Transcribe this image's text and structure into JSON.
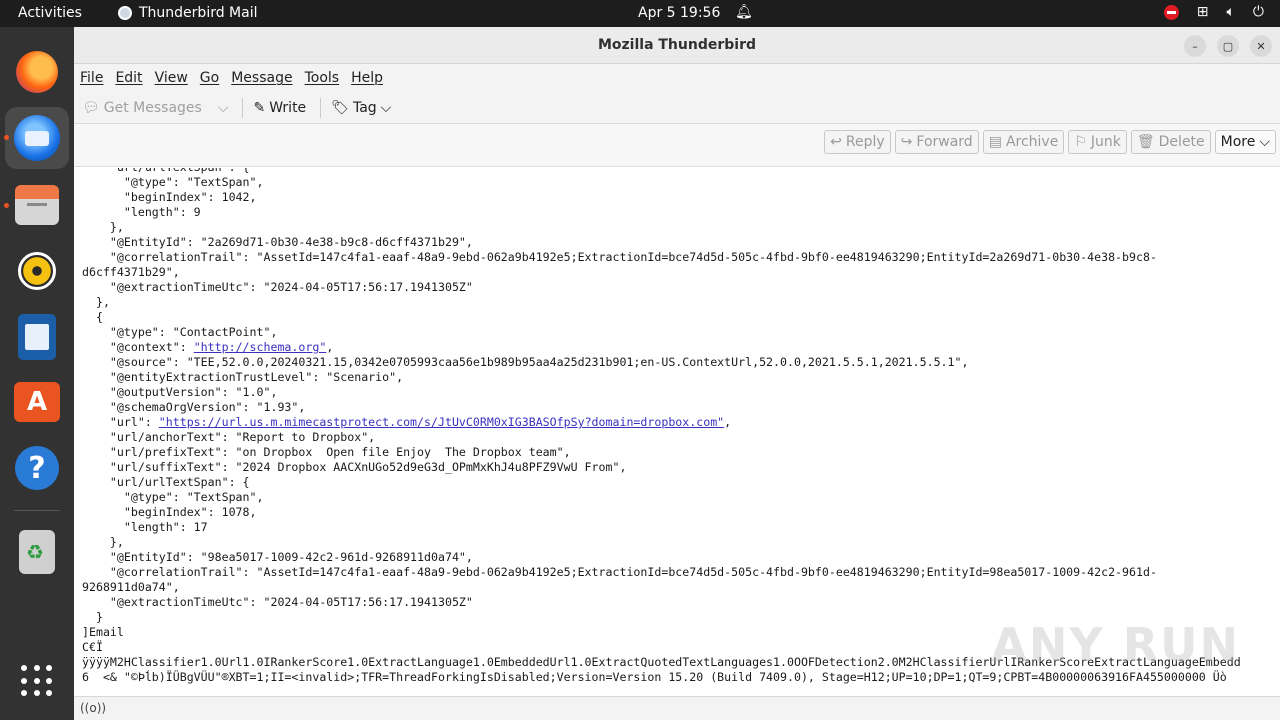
{
  "topbar": {
    "activities": "Activities",
    "app_name": "Thunderbird Mail",
    "clock": "Apr 5  19:56"
  },
  "dock": {
    "items": [
      "firefox-icon",
      "thunderbird-icon",
      "files-icon",
      "rhythmbox-icon",
      "writer-icon",
      "app-center-icon",
      "help-icon",
      "trash-icon",
      "show-apps-icon"
    ]
  },
  "window": {
    "title": "Mozilla Thunderbird",
    "controls": {
      "minimize": "–",
      "maximize": "▢",
      "close": "✕"
    }
  },
  "menu": {
    "file": "File",
    "edit": "Edit",
    "view": "View",
    "go": "Go",
    "message": "Message",
    "tools": "Tools",
    "help": "Help"
  },
  "toolbar": {
    "get_messages": "Get Messages",
    "write": "Write",
    "tag": "Tag"
  },
  "actions": {
    "reply": "Reply",
    "forward": "Forward",
    "archive": "Archive",
    "junk": "Junk",
    "delete": "Delete",
    "more": "More"
  },
  "message_body": {
    "lines": [
      "    \"url/urlTextSpan\": {",
      "      \"@type\": \"TextSpan\",",
      "      \"beginIndex\": 1042,",
      "      \"length\": 9",
      "    },",
      "    \"@EntityId\": \"2a269d71-0b30-4e38-b9c8-d6cff4371b29\",",
      "    \"@correlationTrail\": \"AssetId=147c4fa1-eaaf-48a9-9ebd-062a9b4192e5;ExtractionId=bce74d5d-505c-4fbd-9bf0-ee4819463290;EntityId=2a269d71-0b30-4e38-b9c8-",
      "d6cff4371b29\",",
      "    \"@extractionTimeUtc\": \"2024-04-05T17:56:17.1941305Z\"",
      "  },",
      "  {",
      "    \"@type\": \"ContactPoint\",",
      "    \"@context\": ",
      "    \"@source\": \"TEE,52.0.0,20240321.15,0342e0705993caa56e1b989b95aa4a25d231b901;en-US.ContextUrl,52.0.0,2021.5.5.1,2021.5.5.1\",",
      "    \"@entityExtractionTrustLevel\": \"Scenario\",",
      "    \"@outputVersion\": \"1.0\",",
      "    \"@schemaOrgVersion\": \"1.93\",",
      "    \"url\": ",
      "    \"url/anchorText\": \"Report to Dropbox\",",
      "    \"url/prefixText\": \"on Dropbox  Open file Enjoy  The Dropbox team\",",
      "    \"url/suffixText\": \"2024 Dropbox AACXnUGo52d9eG3d_OPmMxKhJ4u8PFZ9VwU From\",",
      "    \"url/urlTextSpan\": {",
      "      \"@type\": \"TextSpan\",",
      "      \"beginIndex\": 1078,",
      "      \"length\": 17",
      "    },",
      "    \"@EntityId\": \"98ea5017-1009-42c2-961d-9268911d0a74\",",
      "    \"@correlationTrail\": \"AssetId=147c4fa1-eaaf-48a9-9ebd-062a9b4192e5;ExtractionId=bce74d5d-505c-4fbd-9bf0-ee4819463290;EntityId=98ea5017-1009-42c2-961d-",
      "9268911d0a74\",",
      "    \"@extractionTimeUtc\": \"2024-04-05T17:56:17.1941305Z\"",
      "  }",
      "]Email",
      "C€Ï",
      "ÿÿÿÿM2HClassifier1.0Url1.0IRankerScore1.0ExtractLanguage1.0EmbeddedUrl1.0ExtractQuotedTextLanguages1.0OOFDetection2.0M2HClassifierUrlIRankerScoreExtractLanguageEmbedd",
      "6  <& \"©Þĺb)ÏÜBgVÜU\"®XBT=1;II=<invalid>;TFR=ThreadForkingIsDisabled;Version=Version 15.20 (Build 7409.0), Stage=H12;UP=10;DP=1;QT=9;CPBT=4B00000063916FA455000000 Üò"
    ],
    "context_link": "\"http://schema.org\"",
    "url_link": "\"https://url.us.m.mimecastprotect.com/s/JtUvC0RM0xIG3BASOfpSy?domain=dropbox.com\""
  },
  "watermark": "ANY RUN",
  "status": "((o))"
}
